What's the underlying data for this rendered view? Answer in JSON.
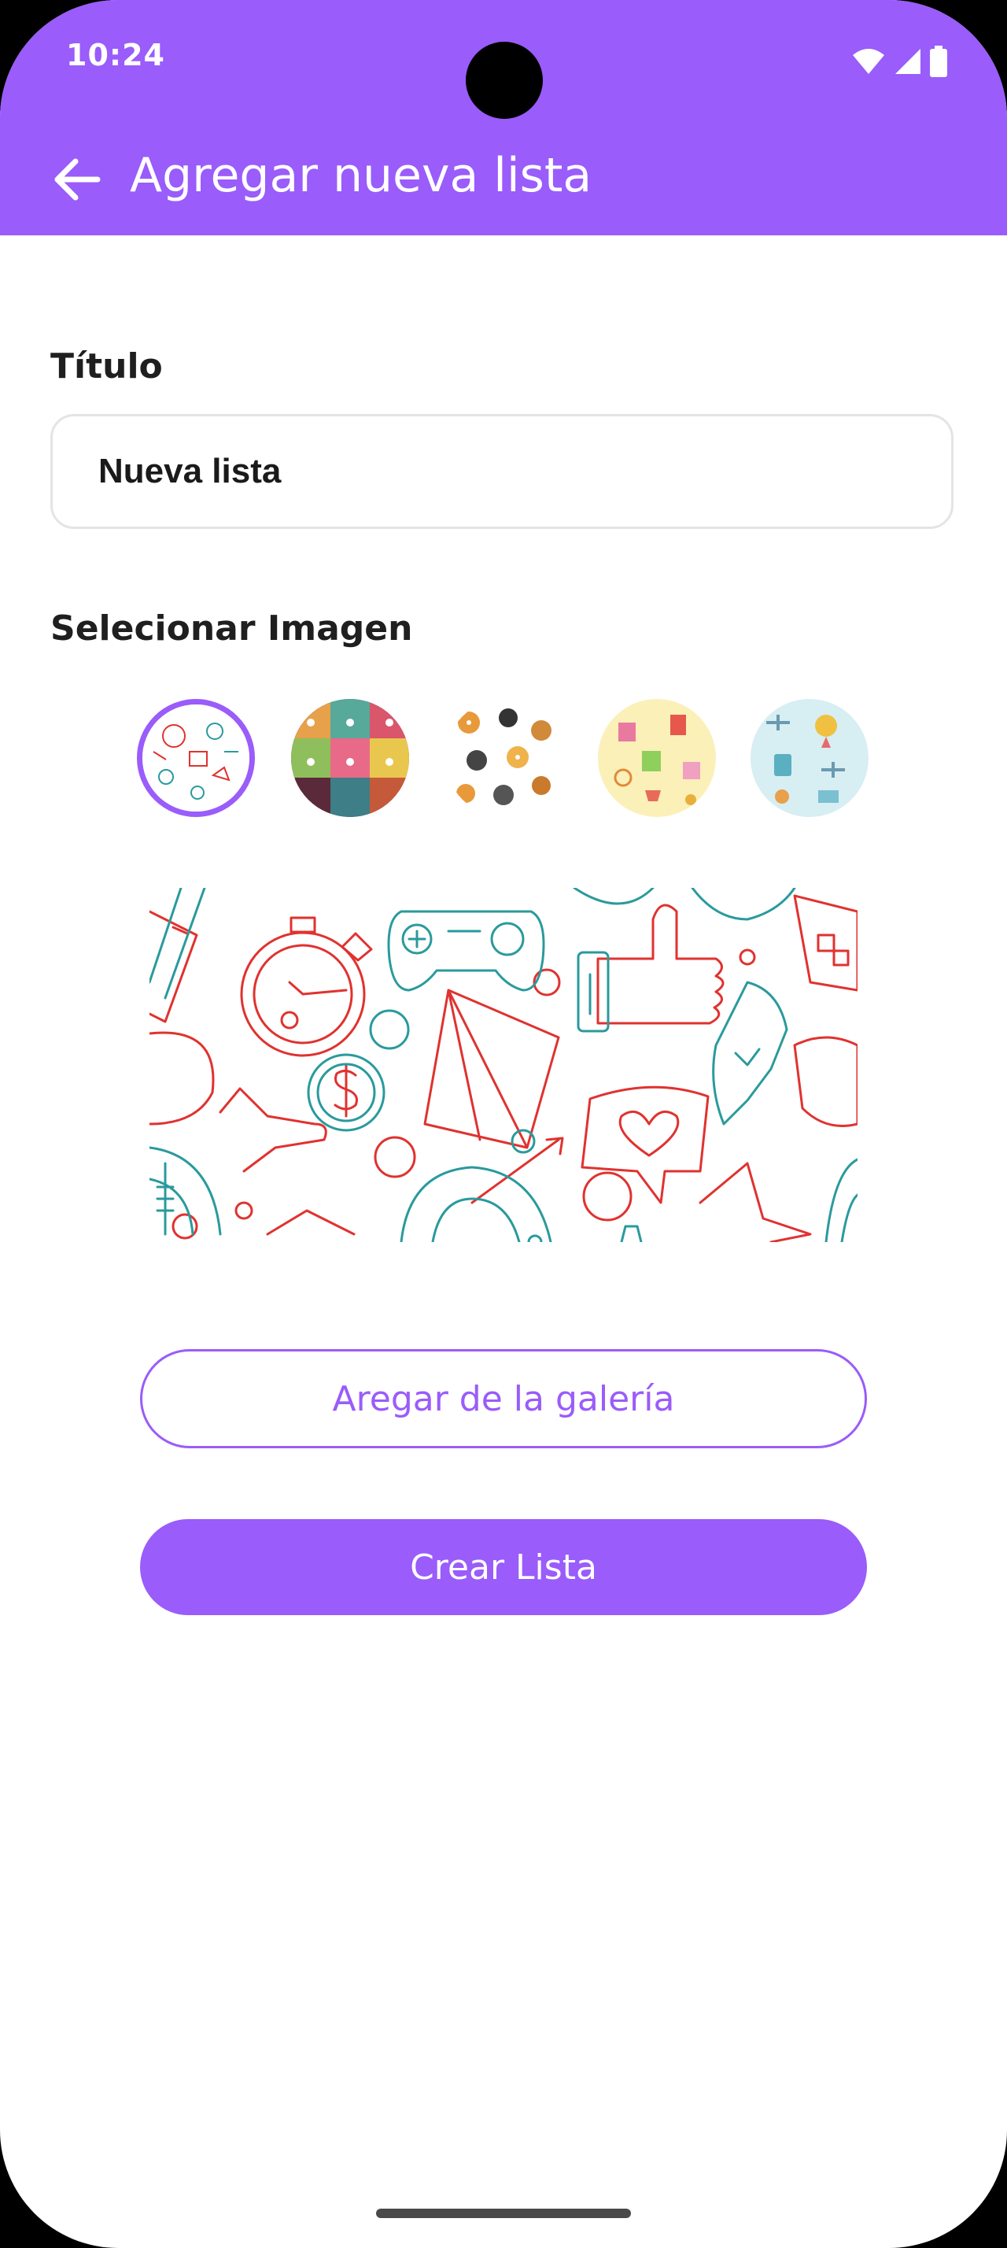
{
  "status_bar": {
    "time": "10:24",
    "icons": [
      "wifi-icon",
      "signal-icon",
      "battery-icon"
    ]
  },
  "app_bar": {
    "back_icon": "arrow-left-icon",
    "title": "Agregar nueva lista"
  },
  "form": {
    "title_label": "Título",
    "title_value": "Nueva lista",
    "image_label": "Selecionar Imagen",
    "images": [
      {
        "name": "doodle-pattern",
        "selected": true
      },
      {
        "name": "cats-pattern",
        "selected": false
      },
      {
        "name": "dogs-pattern",
        "selected": false
      },
      {
        "name": "shopping-pattern",
        "selected": false
      },
      {
        "name": "travel-pattern",
        "selected": false
      }
    ]
  },
  "buttons": {
    "gallery": "Aregar de la galería",
    "create": "Crear Lista"
  },
  "colors": {
    "accent": "#9a5cfa",
    "pattern_red": "#e0322f",
    "pattern_teal": "#2a9a9c"
  }
}
